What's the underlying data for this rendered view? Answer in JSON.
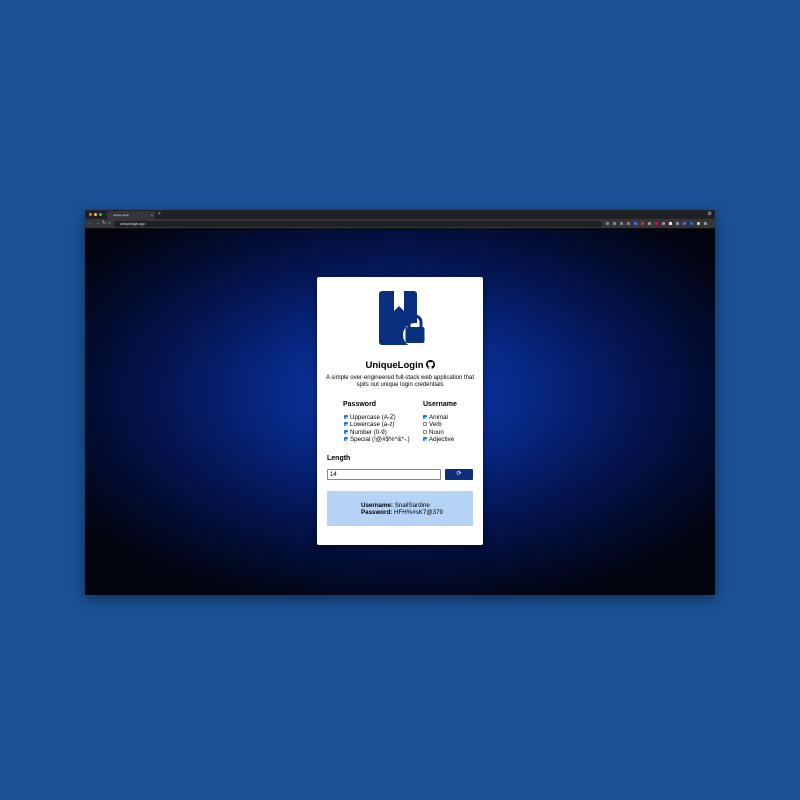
{
  "browser": {
    "tab_title": "unique login",
    "tab_close": "×",
    "new_tab": "+",
    "url": "uniquelogin.app",
    "nav": {
      "back": "←",
      "forward": "→",
      "reload": "↻",
      "home": "⌂"
    },
    "traffic_colors": [
      "#ff5f57",
      "#febc2e",
      "#28c840"
    ],
    "extension_colors": [
      "#888",
      "#888",
      "#888",
      "#888",
      "#4a6cf7",
      "#d33",
      "#999",
      "#e04",
      "#999",
      "#fff",
      "#999",
      "#4a6cf7",
      "#1a73e8",
      "#ccc",
      "#999"
    ]
  },
  "app": {
    "title": "UniqueLogin",
    "subtitle": "A simple over-engineered full-stack web application that spits out unique login credentials",
    "password_heading": "Password",
    "username_heading": "Username",
    "password_options": [
      {
        "label": "Uppercase (A-Z)",
        "checked": true
      },
      {
        "label": "Lowercase (a-z)",
        "checked": true
      },
      {
        "label": "Number (0-9)",
        "checked": true
      },
      {
        "label": "Special (!@#$%^&*-.)",
        "checked": true
      }
    ],
    "username_options": [
      {
        "label": "Animal",
        "checked": true
      },
      {
        "label": "Verb",
        "checked": false
      },
      {
        "label": "Noun",
        "checked": false
      },
      {
        "label": "Adjective",
        "checked": true
      }
    ],
    "length_label": "Length",
    "length_value": "14",
    "generate_icon": "⟳",
    "result": {
      "username_label": "Username:",
      "username_value": "SnailSardine",
      "password_label": "Password:",
      "password_value": "HFH%#sK7@379"
    },
    "colors": {
      "accent": "#0d2f7c",
      "result_bg": "#b5d3f5",
      "logo": "#0b2f7f"
    }
  }
}
